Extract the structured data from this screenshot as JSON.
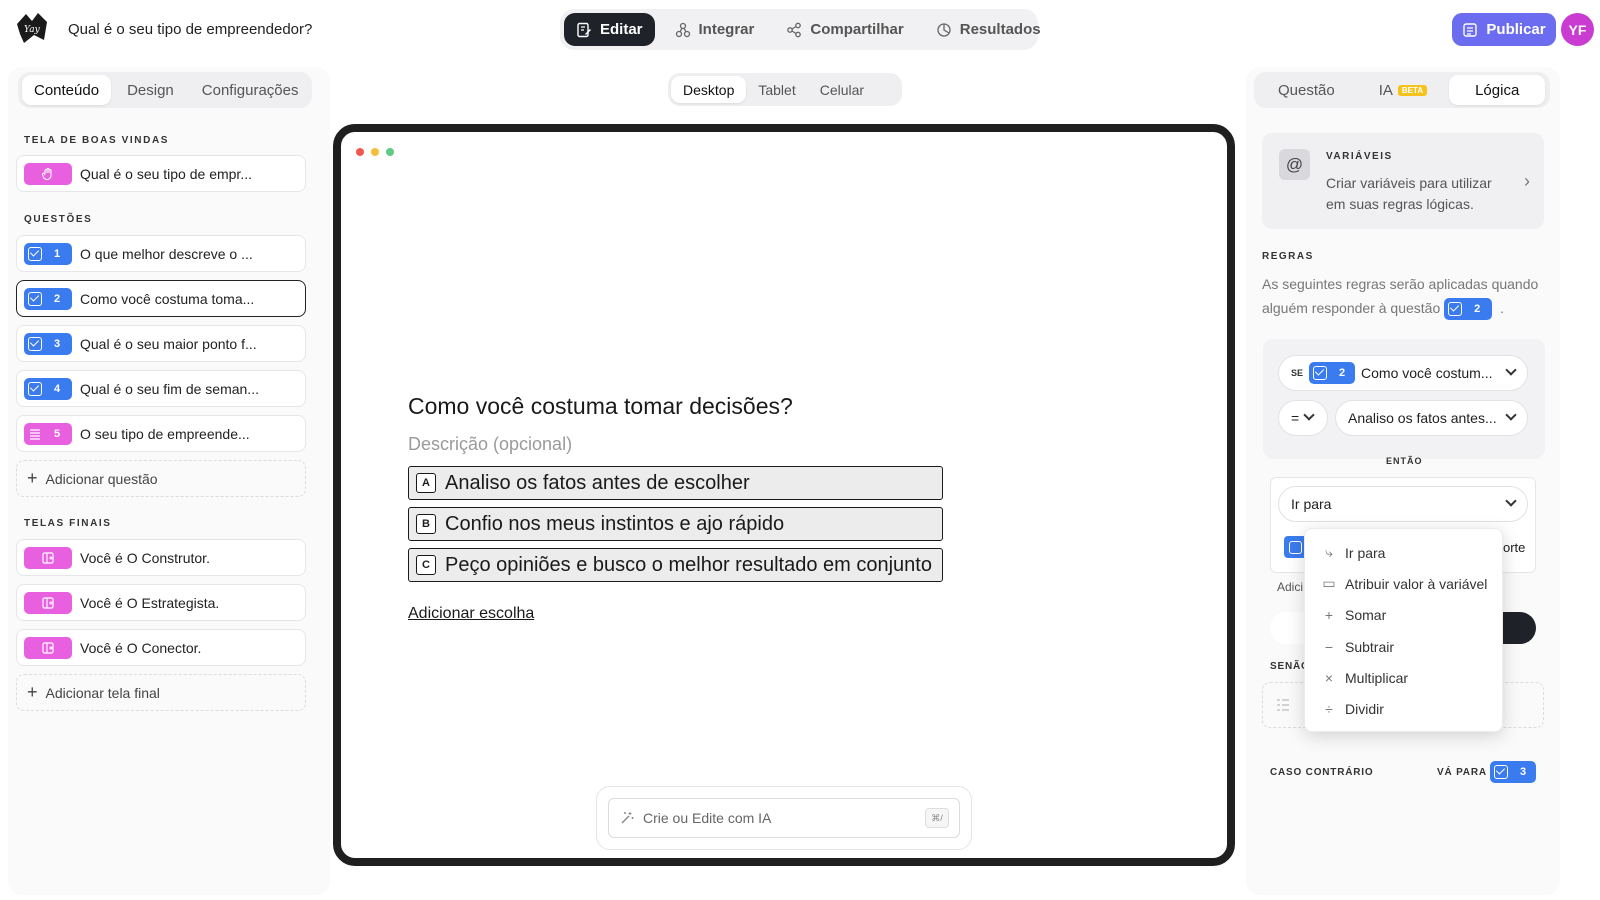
{
  "header": {
    "form_title": "Qual é o seu tipo de empreendedor?",
    "tabs": [
      {
        "label": "Editar",
        "icon": "edit-icon",
        "active": true
      },
      {
        "label": "Integrar",
        "icon": "integrate-icon",
        "active": false
      },
      {
        "label": "Compartilhar",
        "icon": "share-icon",
        "active": false
      },
      {
        "label": "Resultados",
        "icon": "results-icon",
        "active": false
      }
    ],
    "publish_label": "Publicar",
    "avatar_initials": "YF"
  },
  "left": {
    "tabs": [
      "Conteúdo",
      "Design",
      "Configurações"
    ],
    "welcome_label": "TELA DE BOAS VINDAS",
    "welcome_item": "Qual é o seu tipo de empr...",
    "questions_label": "QUESTÕES",
    "questions": [
      {
        "num": "1",
        "text": "O que melhor descreve o ..."
      },
      {
        "num": "2",
        "text": "Como você costuma toma..."
      },
      {
        "num": "3",
        "text": "Qual é o seu maior ponto f..."
      },
      {
        "num": "4",
        "text": "Qual é o seu fim de seman..."
      },
      {
        "num": "5",
        "text": "O seu tipo de empreende..."
      }
    ],
    "add_question": "Adicionar questão",
    "endings_label": "TELAS FINAIS",
    "endings": [
      "Você é O Construtor.",
      "Você é O Estrategista.",
      "Você é O Conector."
    ],
    "add_ending": "Adicionar tela final"
  },
  "center": {
    "devices": [
      "Desktop",
      "Tablet",
      "Celular"
    ],
    "question_title": "Como você costuma tomar decisões?",
    "description_placeholder": "Descrição (opcional)",
    "choices": [
      {
        "key": "A",
        "text": "Analiso os fatos antes de escolher"
      },
      {
        "key": "B",
        "text": "Confio nos meus instintos e ajo rápido"
      },
      {
        "key": "C",
        "text": "Peço opiniões e busco o melhor resultado em conjunto"
      }
    ],
    "add_choice": "Adicionar escolha",
    "ai_placeholder": "Crie ou Edite com IA",
    "ai_shortcut": "⌘/"
  },
  "right": {
    "tabs": [
      "Questão",
      "IA",
      "Lógica"
    ],
    "beta": "BETA",
    "variables_label": "VARIÁVEIS",
    "variables_desc": "Criar variáveis para utilizar em suas regras lógicas.",
    "rules_label": "REGRAS",
    "rules_desc": "As seguintes regras serão aplicadas quando alguém responder à questão",
    "rules_question_num": "2",
    "se_label": "SE",
    "condition_question_num": "2",
    "condition_question": "Como você costum...",
    "operator": "=",
    "condition_value": "Analiso os fatos antes...",
    "entao_label": "ENTÃO",
    "action_value": "Ir para",
    "partial_right_text": "orte",
    "partial_add_text": "Adici",
    "senao_label": "SENÃO",
    "caso_label": "CASO CONTRÁRIO",
    "va_para_label": "VÁ PARA",
    "caso_num": "3",
    "dropdown": [
      {
        "label": "Ir para",
        "icon": "goto-icon"
      },
      {
        "label": "Atribuir valor à variável",
        "icon": "assign-icon"
      },
      {
        "label": "Somar",
        "icon": "plus-icon"
      },
      {
        "label": "Subtrair",
        "icon": "minus-icon"
      },
      {
        "label": "Multiplicar",
        "icon": "multiply-icon"
      },
      {
        "label": "Dividir",
        "icon": "divide-icon"
      }
    ]
  },
  "colors": {
    "accent": "#6b6cf0",
    "question_badge": "#3a7bef",
    "screen_badge": "#e85fe0",
    "avatar": "#c93bd1"
  }
}
